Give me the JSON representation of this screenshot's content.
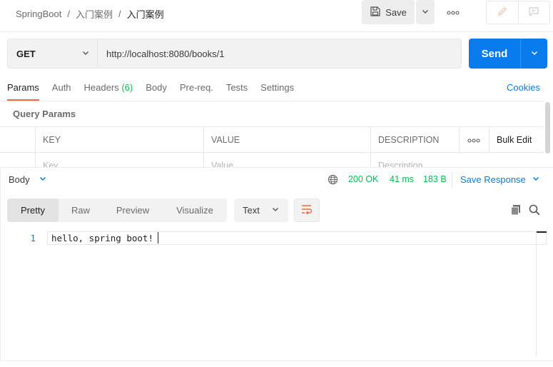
{
  "breadcrumb": {
    "items": [
      "SpringBoot",
      "入门案例"
    ],
    "current": "入门案例",
    "separator": "/"
  },
  "toolbar": {
    "save_label": "Save",
    "more_label": "ooo"
  },
  "request": {
    "method": "GET",
    "url": "http://localhost:8080/books/1",
    "send_label": "Send"
  },
  "req_tabs": [
    {
      "label": "Params",
      "count": "",
      "active": true
    },
    {
      "label": "Auth",
      "count": ""
    },
    {
      "label": "Headers",
      "count": "(6)"
    },
    {
      "label": "Body",
      "count": ""
    },
    {
      "label": "Pre-req.",
      "count": ""
    },
    {
      "label": "Tests",
      "count": ""
    },
    {
      "label": "Settings",
      "count": ""
    }
  ],
  "cookies_label": "Cookies",
  "query_params": {
    "title": "Query Params",
    "headers": {
      "key": "KEY",
      "value": "VALUE",
      "description": "DESCRIPTION",
      "more": "ooo",
      "bulk_edit": "Bulk Edit"
    },
    "placeholder_row": {
      "key": "Key",
      "value": "Value",
      "description": "Description"
    }
  },
  "response": {
    "section_label": "Body",
    "status": "200 OK",
    "time": "41 ms",
    "size": "183 B",
    "save_label": "Save Response",
    "view_tabs": [
      "Pretty",
      "Raw",
      "Preview",
      "Visualize"
    ],
    "active_view": "Pretty",
    "format": "Text",
    "lines": [
      {
        "number": "1",
        "text": "hello, spring boot!"
      }
    ]
  },
  "colors": {
    "accent": "#097bed",
    "status_green": "#0cbb52",
    "active_tab_underline": "#f26b3a"
  },
  "icons": [
    "save-icon",
    "chevron-down-icon",
    "more-icon",
    "pencil-icon",
    "comment-icon",
    "globe-icon",
    "wrap-icon",
    "copy-icon",
    "search-icon"
  ]
}
